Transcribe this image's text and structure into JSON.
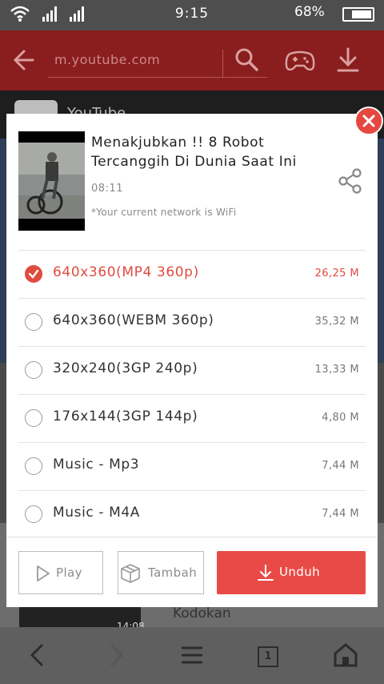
{
  "status_bar": {
    "time": "9:15",
    "battery": "68%",
    "icons": [
      "wifi-icon",
      "signal-icon",
      "signal-icon",
      "battery-icon"
    ]
  },
  "browser": {
    "url": "m.youtube.com",
    "icons": [
      "back-arrow-icon",
      "search-icon",
      "game-controller-icon",
      "download-icon"
    ]
  },
  "background_page": {
    "site_label": "YouTube",
    "video_title": "Kodokan",
    "video_duration": "14:08"
  },
  "dialog": {
    "title": "Menakjubkan !! 8 Robot Tercanggih Di Dunia Saat Ini",
    "duration": "08:11",
    "network_note": "*Your current network is WiFi",
    "formats": [
      {
        "label": "640x360(MP4 360p)",
        "size": "26,25 M",
        "selected": true
      },
      {
        "label": "640x360(WEBM 360p)",
        "size": "35,32 M",
        "selected": false
      },
      {
        "label": "320x240(3GP 240p)",
        "size": "13,33 M",
        "selected": false
      },
      {
        "label": "176x144(3GP 144p)",
        "size": "4,80 M",
        "selected": false
      },
      {
        "label": "Music - Mp3",
        "size": "7,44 M",
        "selected": false
      },
      {
        "label": "Music - M4A",
        "size": "7,44 M",
        "selected": false
      }
    ],
    "buttons": {
      "play": "Play",
      "add": "Tambah",
      "download": "Unduh"
    }
  },
  "bottom_nav": {
    "tab_count": "1",
    "icons": [
      "back-icon",
      "forward-icon",
      "menu-icon",
      "tabs-icon",
      "home-icon"
    ]
  },
  "colors": {
    "accent": "#e04b3f",
    "toolbar": "#8a1d1d",
    "download_button": "#e84b47"
  }
}
